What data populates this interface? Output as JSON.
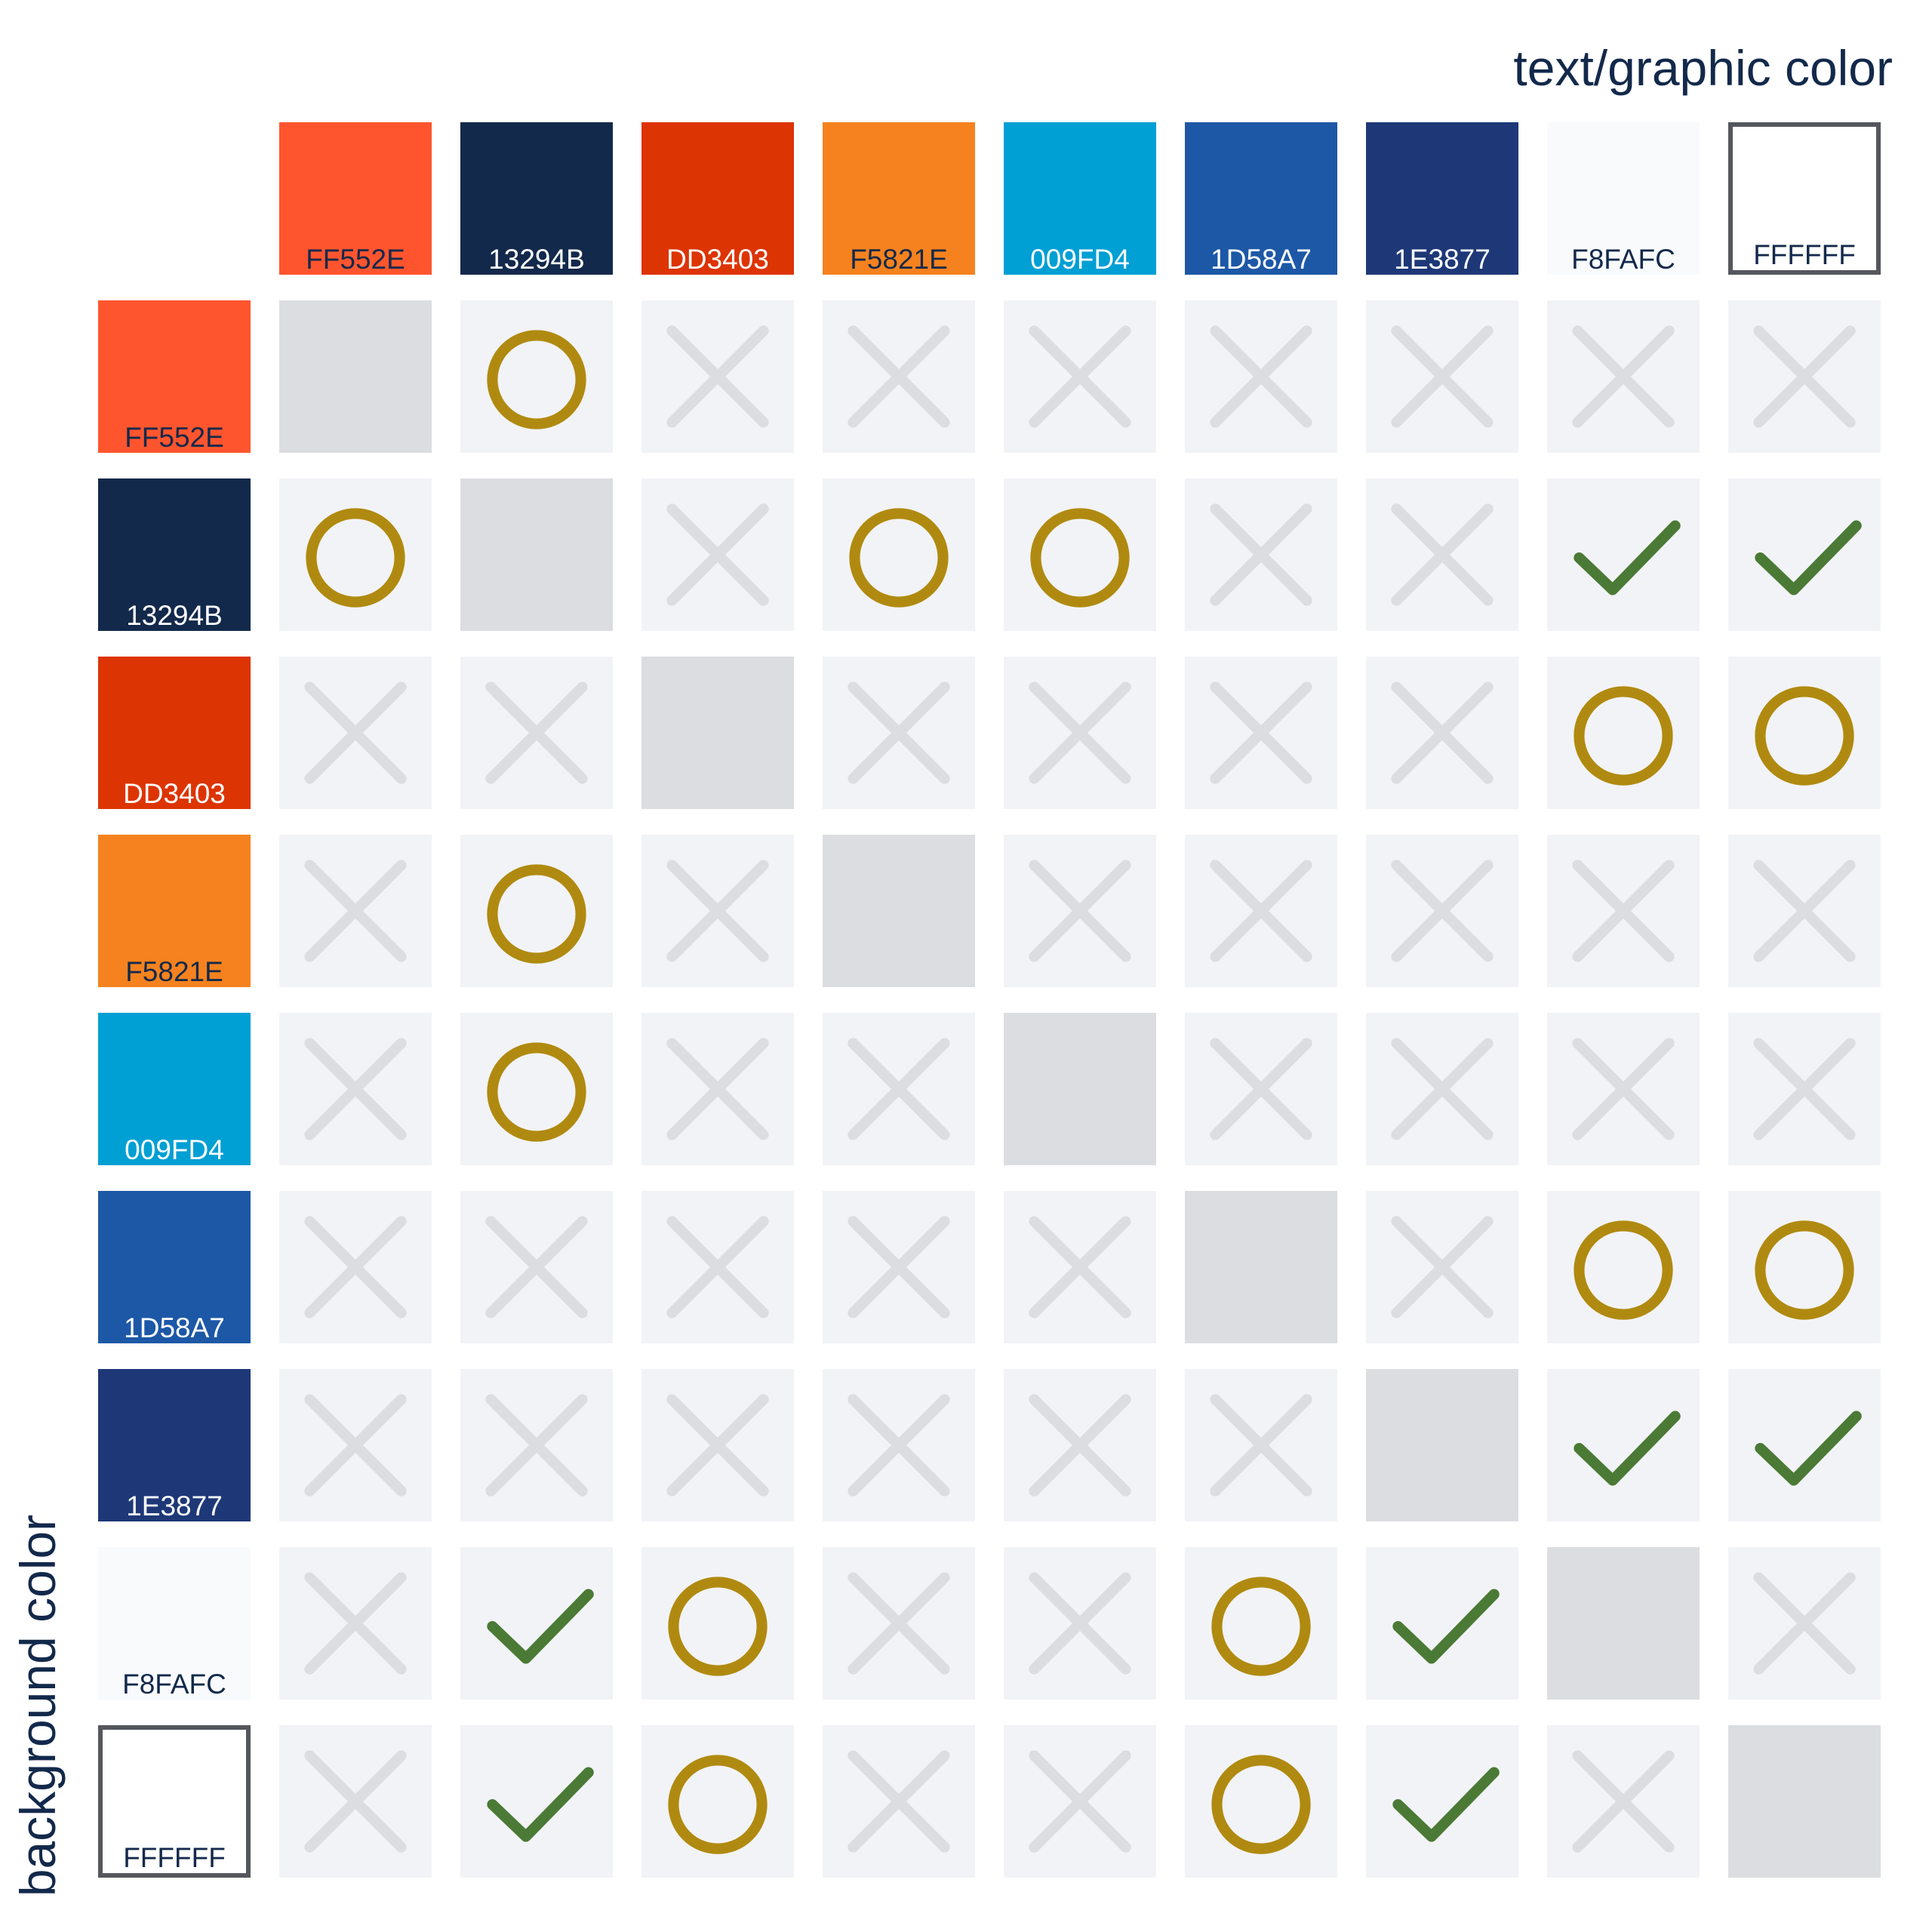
{
  "axis": {
    "top_label": "text/graphic color",
    "left_label": "background color"
  },
  "colors": [
    {
      "hex": "FF552E",
      "swatch": "#FF552E",
      "label_color": "#13294B"
    },
    {
      "hex": "13294B",
      "swatch": "#13294B",
      "label_color": "#FFFFFF"
    },
    {
      "hex": "DD3403",
      "swatch": "#DD3403",
      "label_color": "#FFFFFF"
    },
    {
      "hex": "F5821E",
      "swatch": "#F5821E",
      "label_color": "#13294B"
    },
    {
      "hex": "009FD4",
      "swatch": "#009FD4",
      "label_color": "#FFFFFF"
    },
    {
      "hex": "1D58A7",
      "swatch": "#1D58A7",
      "label_color": "#FFFFFF"
    },
    {
      "hex": "1E3877",
      "swatch": "#1E3877",
      "label_color": "#FFFFFF"
    },
    {
      "hex": "F8FAFC",
      "swatch": "#F8FAFC",
      "label_color": "#13294B"
    },
    {
      "hex": "FFFFFF",
      "swatch": "#FFFFFF",
      "label_color": "#13294B",
      "outlined": true
    }
  ],
  "legend_semantics": {
    "check": "passes",
    "circle": "partial pass",
    "cross": "fails",
    "self": "same color"
  },
  "symbol_colors": {
    "check": "#4A7A35",
    "circle": "#B08A10",
    "cross": "#DCDDE1"
  },
  "matrix": [
    [
      "self",
      "circle",
      "cross",
      "cross",
      "cross",
      "cross",
      "cross",
      "cross",
      "cross"
    ],
    [
      "circle",
      "self",
      "cross",
      "circle",
      "circle",
      "cross",
      "cross",
      "check",
      "check"
    ],
    [
      "cross",
      "cross",
      "self",
      "cross",
      "cross",
      "cross",
      "cross",
      "circle",
      "circle"
    ],
    [
      "cross",
      "circle",
      "cross",
      "self",
      "cross",
      "cross",
      "cross",
      "cross",
      "cross"
    ],
    [
      "cross",
      "circle",
      "cross",
      "cross",
      "self",
      "cross",
      "cross",
      "cross",
      "cross"
    ],
    [
      "cross",
      "cross",
      "cross",
      "cross",
      "cross",
      "self",
      "cross",
      "circle",
      "circle"
    ],
    [
      "cross",
      "cross",
      "cross",
      "cross",
      "cross",
      "cross",
      "self",
      "check",
      "check"
    ],
    [
      "cross",
      "check",
      "circle",
      "cross",
      "cross",
      "circle",
      "check",
      "self",
      "cross"
    ],
    [
      "cross",
      "check",
      "circle",
      "cross",
      "cross",
      "circle",
      "check",
      "cross",
      "self"
    ]
  ]
}
